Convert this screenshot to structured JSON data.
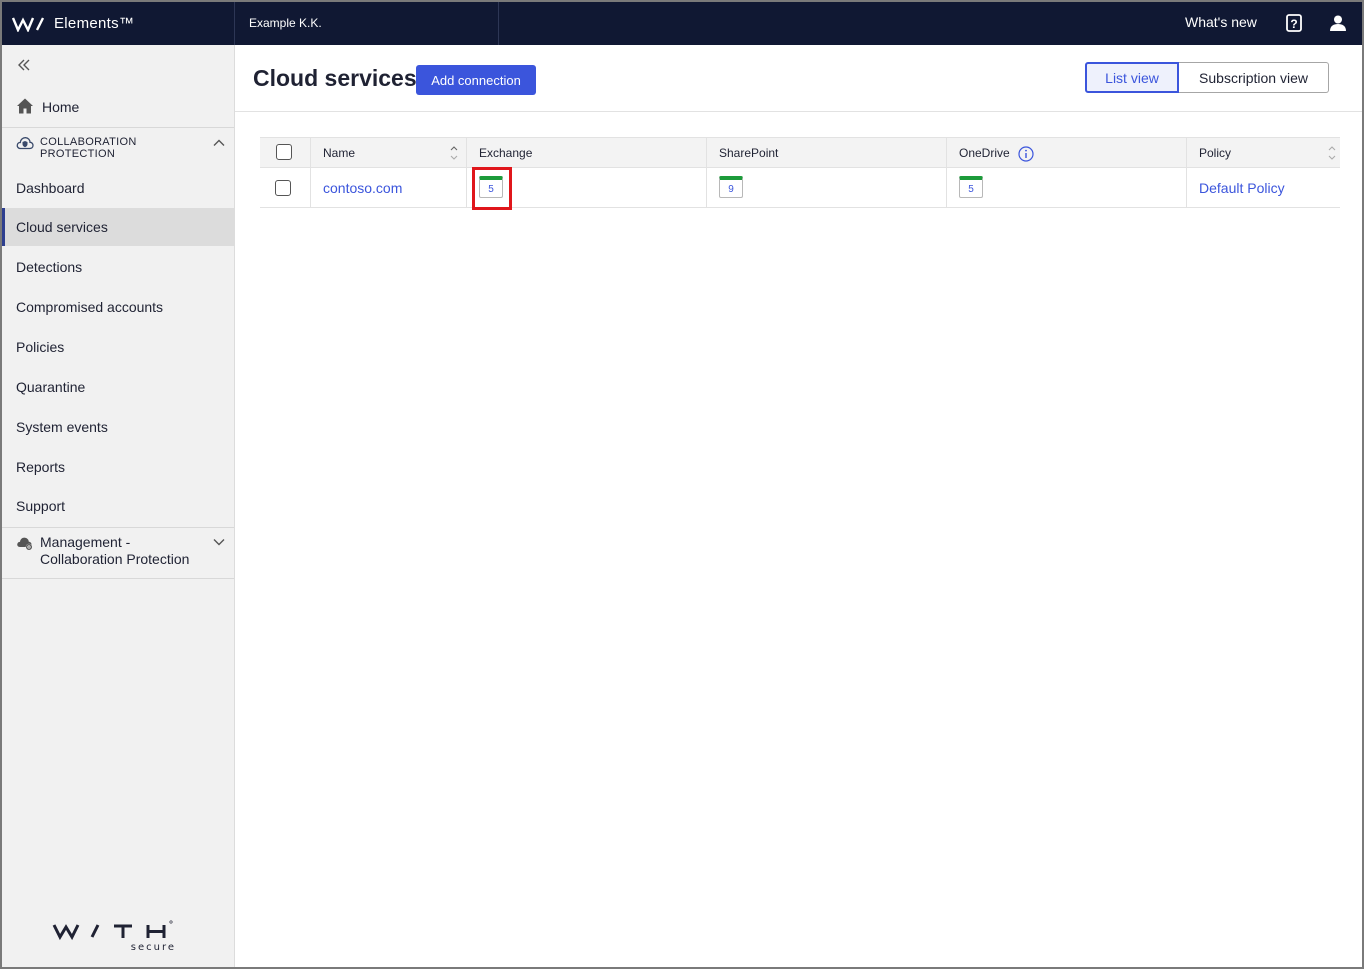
{
  "topbar": {
    "brand": "Elements™",
    "organization": "Example K.K.",
    "whats_new": "What's new",
    "help_icon": "help-question-icon",
    "user_icon": "user-icon"
  },
  "sidebar": {
    "collapse_icon": "double-chevron-left-icon",
    "home": "Home",
    "group": {
      "title_line1": "COLLABORATION",
      "title_line2": "PROTECTION",
      "icon": "cloud-shield-icon"
    },
    "items": [
      {
        "label": "Dashboard"
      },
      {
        "label": "Cloud services",
        "active": true
      },
      {
        "label": "Detections"
      },
      {
        "label": "Compromised accounts"
      },
      {
        "label": "Policies"
      },
      {
        "label": "Quarantine"
      },
      {
        "label": "System events"
      },
      {
        "label": "Reports"
      },
      {
        "label": "Support"
      }
    ],
    "management": {
      "line1": "Management -",
      "line2": "Collaboration Protection",
      "icon": "cloud-gear-icon"
    },
    "footer_logo": "WithSecure"
  },
  "main": {
    "title": "Cloud services",
    "add_button": "Add connection",
    "views": {
      "list": "List view",
      "subscription": "Subscription view",
      "active": "list"
    },
    "table": {
      "columns": [
        "Name",
        "Exchange",
        "SharePoint",
        "OneDrive",
        "Policy"
      ],
      "rows": [
        {
          "name": "contoso.com",
          "exchange": "5",
          "sharepoint": "9",
          "onedrive": "5",
          "policy": "Default Policy"
        }
      ]
    }
  },
  "colors": {
    "topbar": "#101833",
    "accent": "#3b55dc",
    "status_ok": "#1c9b3a",
    "highlight": "#e0161b"
  }
}
